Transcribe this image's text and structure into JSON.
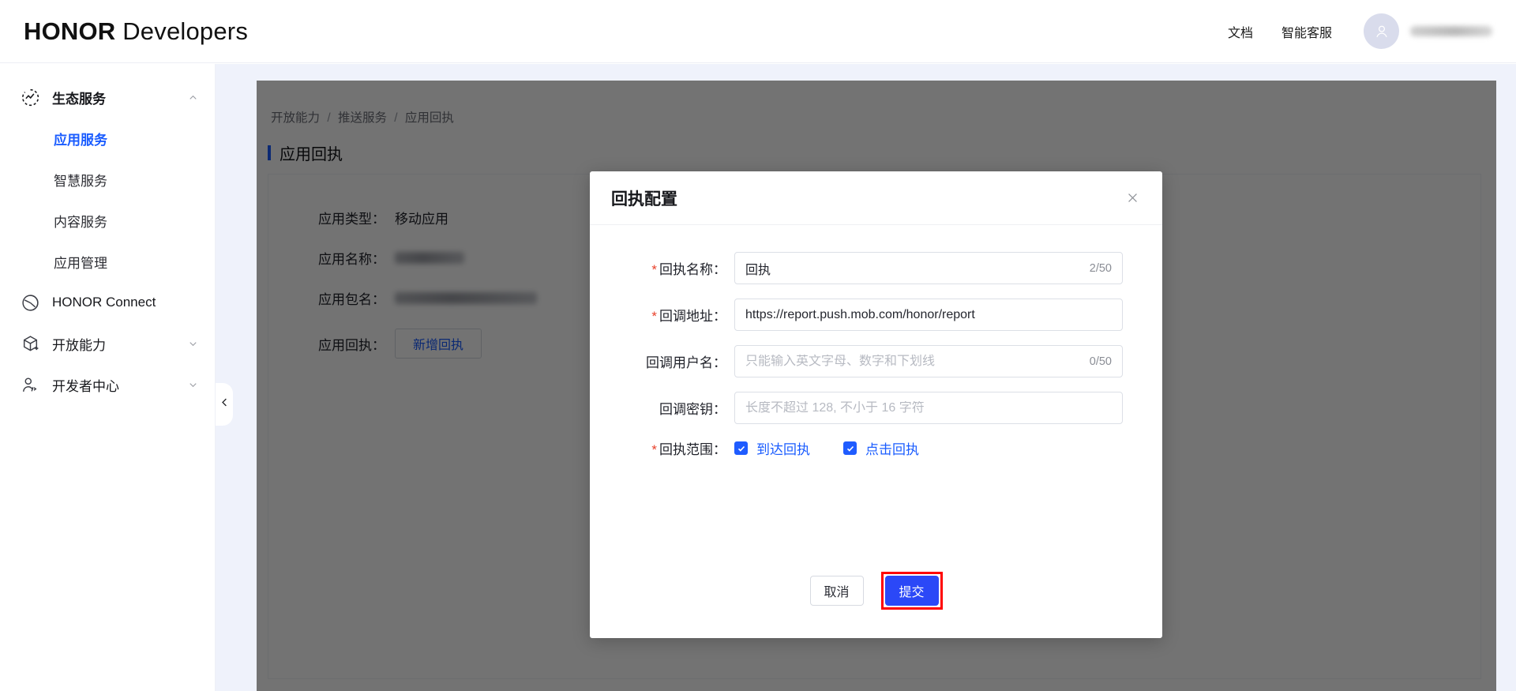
{
  "header": {
    "brand_bold": "HONOR",
    "brand_light": "Developers",
    "nav": [
      {
        "label": "文档",
        "name": "nav-docs"
      },
      {
        "label": "智能客服",
        "name": "nav-support"
      }
    ],
    "avatar_icon": "user-avatar-icon",
    "username_masked": ""
  },
  "sidebar": {
    "groups": [
      {
        "label": "生态服务",
        "icon": "ecosystem-icon",
        "expanded": true,
        "chevron": "chevron-up-icon",
        "children": [
          {
            "label": "应用服务",
            "active": true
          },
          {
            "label": "智慧服务",
            "active": false
          },
          {
            "label": "内容服务",
            "active": false
          },
          {
            "label": "应用管理",
            "active": false
          }
        ]
      },
      {
        "label": "HONOR Connect",
        "icon": "connect-icon",
        "expanded": false,
        "chevron": ""
      },
      {
        "label": "开放能力",
        "icon": "cube-plus-icon",
        "expanded": false,
        "chevron": "chevron-down-icon"
      },
      {
        "label": "开发者中心",
        "icon": "developer-icon",
        "expanded": false,
        "chevron": "chevron-down-icon"
      }
    ],
    "collapse_icon": "chevron-left-icon"
  },
  "content": {
    "breadcrumb": [
      "开放能力",
      "推送服务",
      "应用回执"
    ],
    "breadcrumb_separator": "/",
    "page_title": "应用回执",
    "info": [
      {
        "label": "应用类型：",
        "value": "移动应用",
        "masked": false
      },
      {
        "label": "应用名称：",
        "value": "",
        "masked": true,
        "mask_width": 88
      },
      {
        "label": "应用包名：",
        "value": "",
        "masked": true,
        "mask_width": 180
      },
      {
        "label": "应用回执：",
        "value": "",
        "masked": false,
        "button": "新增回执"
      }
    ]
  },
  "dialog": {
    "title": "回执配置",
    "close_icon": "close-icon",
    "fields": [
      {
        "label": "回执名称：",
        "required": true,
        "value": "回执",
        "placeholder": "",
        "counter": "2/50",
        "name": "receipt-name"
      },
      {
        "label": "回调地址：",
        "required": true,
        "value": "https://report.push.mob.com/honor/report",
        "placeholder": "",
        "counter": "",
        "name": "callback-url"
      },
      {
        "label": "回调用户名：",
        "required": false,
        "value": "",
        "placeholder": "只能输入英文字母、数字和下划线",
        "counter": "0/50",
        "name": "callback-username"
      },
      {
        "label": "回调密钥：",
        "required": false,
        "value": "",
        "placeholder": "长度不超过 128, 不小于 16 字符",
        "counter": "",
        "name": "callback-secret"
      }
    ],
    "scope": {
      "label": "回执范围：",
      "required": true,
      "options": [
        {
          "label": "到达回执",
          "checked": true,
          "name": "scope-delivered"
        },
        {
          "label": "点击回执",
          "checked": true,
          "name": "scope-clicked"
        }
      ]
    },
    "buttons": {
      "cancel": "取消",
      "submit": "提交",
      "submit_highlighted": true
    }
  },
  "colors": {
    "accent_blue": "#1a5cff",
    "submit_blue": "#2b48f7",
    "required_red": "#e8402a",
    "highlight_red": "#ff0000",
    "canvas_bg": "#eff2fb"
  }
}
